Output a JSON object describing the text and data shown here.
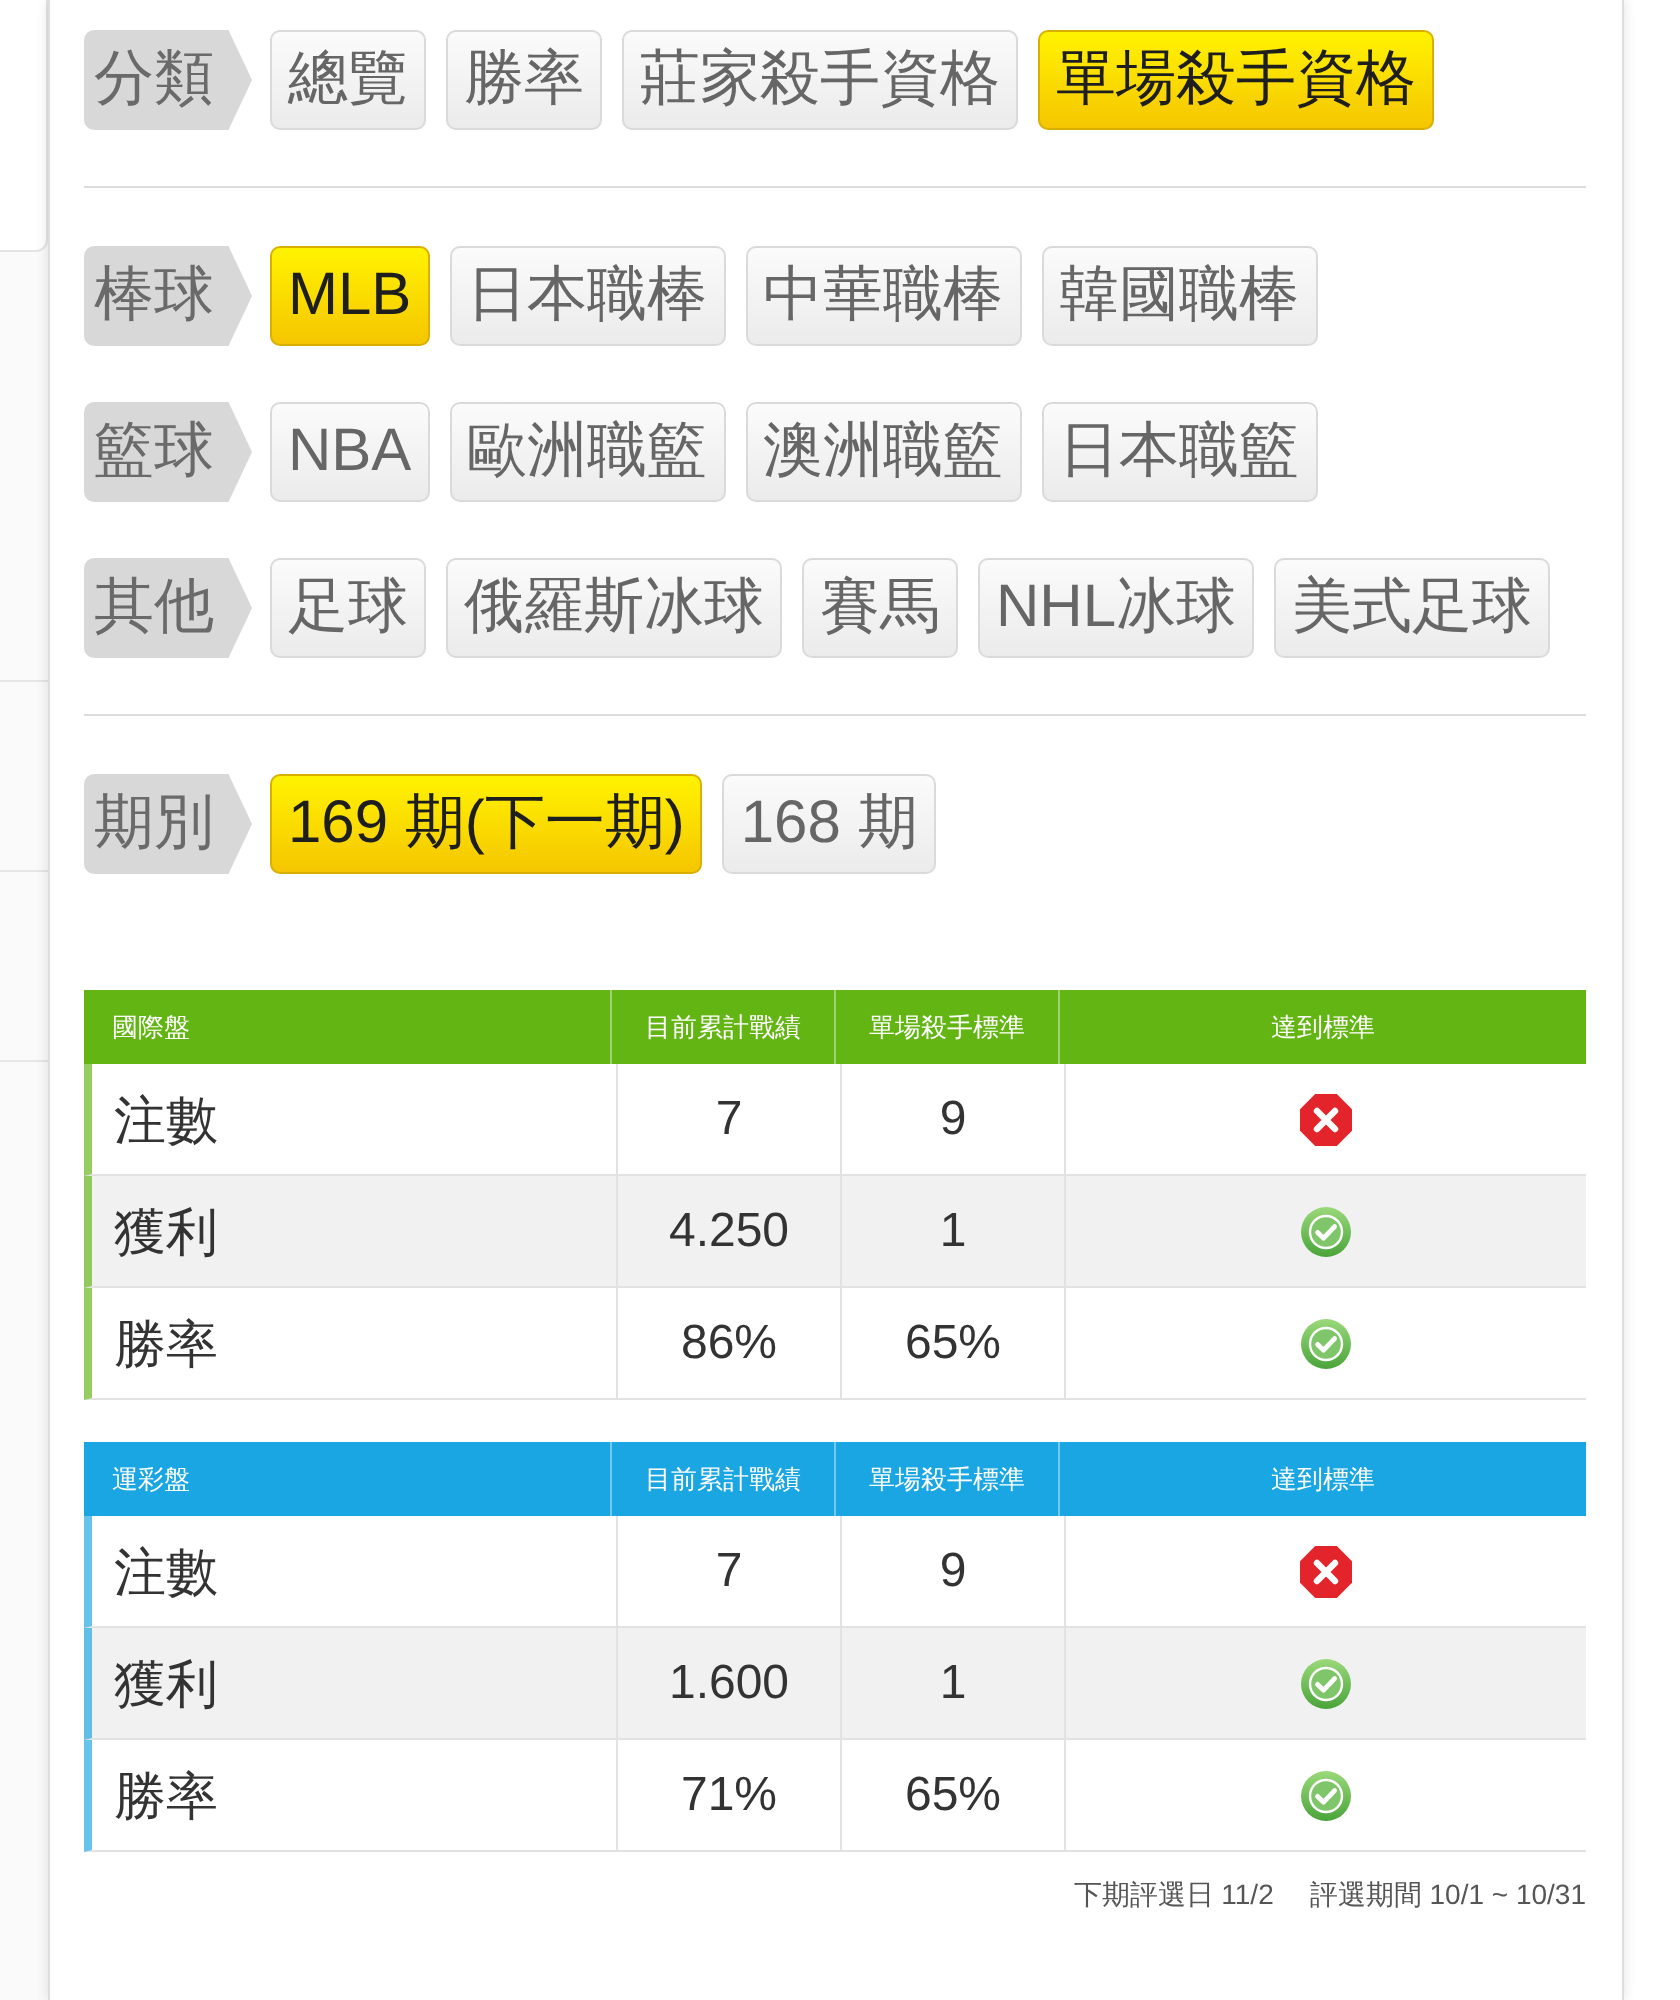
{
  "filter_sections": [
    {
      "rows": [
        {
          "label": "分類",
          "options": [
            {
              "text": "總覽",
              "selected": false
            },
            {
              "text": "勝率",
              "selected": false
            },
            {
              "text": "莊家殺手資格",
              "selected": false
            },
            {
              "text": "單場殺手資格",
              "selected": true
            }
          ]
        }
      ]
    },
    {
      "rows": [
        {
          "label": "棒球",
          "options": [
            {
              "text": "MLB",
              "selected": true
            },
            {
              "text": "日本職棒",
              "selected": false
            },
            {
              "text": "中華職棒",
              "selected": false
            },
            {
              "text": "韓國職棒",
              "selected": false
            }
          ]
        },
        {
          "label": "籃球",
          "options": [
            {
              "text": "NBA",
              "selected": false
            },
            {
              "text": "歐洲職籃",
              "selected": false
            },
            {
              "text": "澳洲職籃",
              "selected": false
            },
            {
              "text": "日本職籃",
              "selected": false
            }
          ]
        },
        {
          "label": "其他",
          "options": [
            {
              "text": "足球",
              "selected": false
            },
            {
              "text": "俄羅斯冰球",
              "selected": false
            },
            {
              "text": "賽馬",
              "selected": false
            },
            {
              "text": "NHL冰球",
              "selected": false
            },
            {
              "text": "美式足球",
              "selected": false
            }
          ]
        }
      ]
    },
    {
      "rows": [
        {
          "label": "期別",
          "options": [
            {
              "text": "169 期(下一期)",
              "selected": true
            },
            {
              "text": "168 期",
              "selected": false
            }
          ]
        }
      ]
    }
  ],
  "tables": [
    {
      "color": "#62b512",
      "columns": [
        "國際盤",
        "目前累計戰績",
        "單場殺手標準",
        "達到標準"
      ],
      "rows": [
        {
          "label": "注數",
          "current": "7",
          "standard": "9",
          "met": false
        },
        {
          "label": "獲利",
          "current": "4.250",
          "standard": "1",
          "met": true
        },
        {
          "label": "勝率",
          "current": "86%",
          "standard": "65%",
          "met": true
        }
      ]
    },
    {
      "color": "#1aa5e3",
      "columns": [
        "運彩盤",
        "目前累計戰績",
        "單場殺手標準",
        "達到標準"
      ],
      "rows": [
        {
          "label": "注數",
          "current": "7",
          "standard": "9",
          "met": false
        },
        {
          "label": "獲利",
          "current": "1.600",
          "standard": "1",
          "met": true
        },
        {
          "label": "勝率",
          "current": "71%",
          "standard": "65%",
          "met": true
        }
      ]
    }
  ],
  "footer": {
    "next_review": "下期評選日 11/2",
    "period": "評選期間 10/1 ~ 10/31"
  }
}
